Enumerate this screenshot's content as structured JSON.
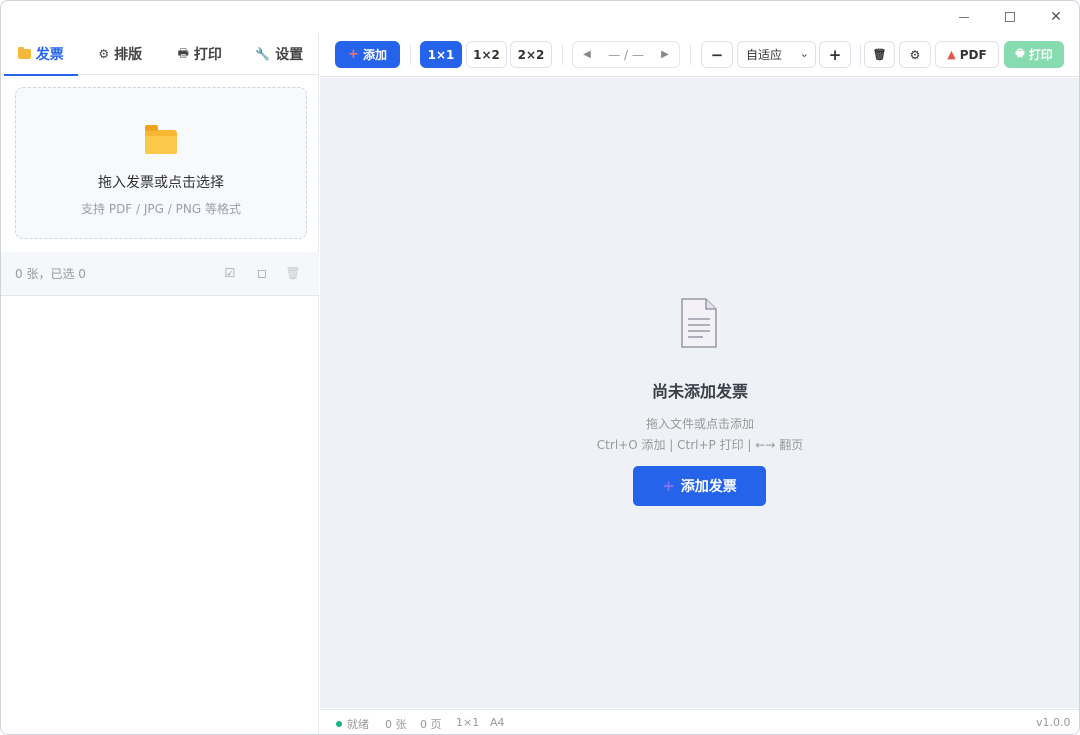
{
  "window": {
    "controls": {
      "minimize": "—",
      "maximize": "☐",
      "close": "✕"
    }
  },
  "sidebar": {
    "tabs": [
      {
        "label": "发票",
        "icon": "folder-icon",
        "active": true
      },
      {
        "label": "排版",
        "icon": "gear-icon",
        "glyph": "⚙"
      },
      {
        "label": "打印",
        "icon": "printer-icon",
        "glyph": "🖶"
      },
      {
        "label": "设置",
        "icon": "wrench-icon",
        "glyph": "🔧"
      }
    ],
    "dropzone": {
      "title": "拖入发票或点击选择",
      "subtitle": "支持 PDF / JPG / PNG 等格式"
    },
    "list": {
      "count_text": "0 张，已选 0",
      "select_all_icon": "☑",
      "deselect_icon": "◻",
      "delete_icon": "🗑"
    }
  },
  "toolbar": {
    "add_label": "添加",
    "layout_options": [
      "1×1",
      "1×2",
      "2×2"
    ],
    "layout_selected": "1×1",
    "pager": {
      "prev": "◀",
      "text": "— / —",
      "next": "▶"
    },
    "zoom_out": "−",
    "zoom_value": "自适应",
    "zoom_in": "+",
    "clear_icon": "🗑",
    "settings_icon": "⚙",
    "pdf_label": "PDF",
    "print_label": "打印"
  },
  "main": {
    "empty_title": "尚未添加发票",
    "empty_hint1": "拖入文件或点击添加",
    "empty_hint2": "Ctrl+O 添加 | Ctrl+P 打印 | ←→ 翻页",
    "add_button": "添加发票"
  },
  "statusbar": {
    "status": "就绪",
    "count": "0 张",
    "pages": "0 页",
    "layout": "1×1",
    "paper": "A4",
    "version": "v1.0.0"
  },
  "colors": {
    "accent": "#2563eb",
    "print_button": "#86dcae",
    "status_ok": "#16b67a",
    "canvas_bg": "#eef1f6"
  }
}
